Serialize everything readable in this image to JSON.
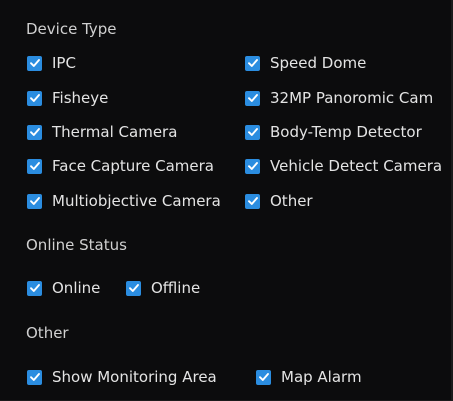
{
  "sections": {
    "device_type": {
      "title": "Device Type",
      "items": [
        {
          "label": "IPC",
          "checked": true
        },
        {
          "label": "Fisheye",
          "checked": true
        },
        {
          "label": "Thermal Camera",
          "checked": true
        },
        {
          "label": "Face Capture Camera",
          "checked": true
        },
        {
          "label": "Multiobjective Camera",
          "checked": true
        },
        {
          "label": "Speed Dome",
          "checked": true
        },
        {
          "label": "32MP Panoromic Cam",
          "checked": true
        },
        {
          "label": "Body-Temp Detector",
          "checked": true
        },
        {
          "label": "Vehicle Detect Camera",
          "checked": true
        },
        {
          "label": "Other",
          "checked": true
        }
      ]
    },
    "online_status": {
      "title": "Online Status",
      "items": [
        {
          "label": "Online",
          "checked": true
        },
        {
          "label": "Offline",
          "checked": true
        }
      ]
    },
    "other": {
      "title": "Other",
      "items": [
        {
          "label": "Show Monitoring Area",
          "checked": true
        },
        {
          "label": "Map Alarm",
          "checked": true
        }
      ]
    }
  },
  "colors": {
    "checkbox_fill": "#2b8de0",
    "background": "#0c0c0d"
  },
  "icons": {
    "checkbox_checked": "checkmark-icon"
  }
}
